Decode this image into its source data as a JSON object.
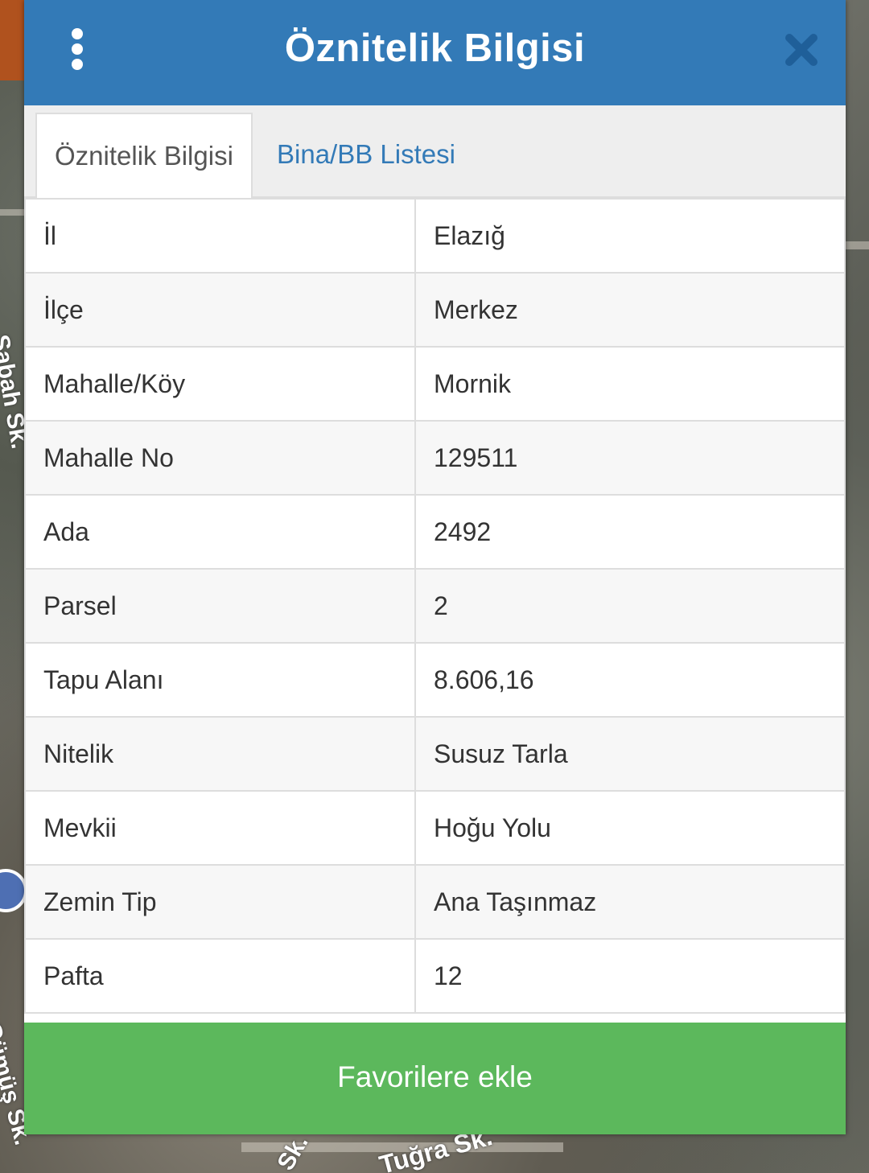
{
  "map": {
    "labels": [
      "Sabah Sk.",
      "Tuğra Sk.",
      "Sk.",
      "Gümüş Sk."
    ]
  },
  "dialog": {
    "title": "Öznitelik Bilgisi",
    "menu_icon": "vertical-ellipsis-icon",
    "close_icon": "close-x-icon",
    "accent_color": "#337ab7",
    "button_color": "#5cb85c"
  },
  "tabs": [
    {
      "label": "Öznitelik Bilgisi",
      "active": true
    },
    {
      "label": "Bina/BB Listesi",
      "active": false
    }
  ],
  "attributes": [
    {
      "key": "İl",
      "value": "Elazığ"
    },
    {
      "key": "İlçe",
      "value": "Merkez"
    },
    {
      "key": "Mahalle/Köy",
      "value": "Mornik"
    },
    {
      "key": "Mahalle No",
      "value": "129511"
    },
    {
      "key": "Ada",
      "value": "2492"
    },
    {
      "key": "Parsel",
      "value": "2"
    },
    {
      "key": "Tapu Alanı",
      "value": "8.606,16"
    },
    {
      "key": "Nitelik",
      "value": "Susuz Tarla"
    },
    {
      "key": "Mevkii",
      "value": "Hoğu Yolu"
    },
    {
      "key": "Zemin Tip",
      "value": "Ana Taşınmaz"
    },
    {
      "key": "Pafta",
      "value": "12"
    }
  ],
  "footer": {
    "button_label": "Favorilere ekle"
  }
}
